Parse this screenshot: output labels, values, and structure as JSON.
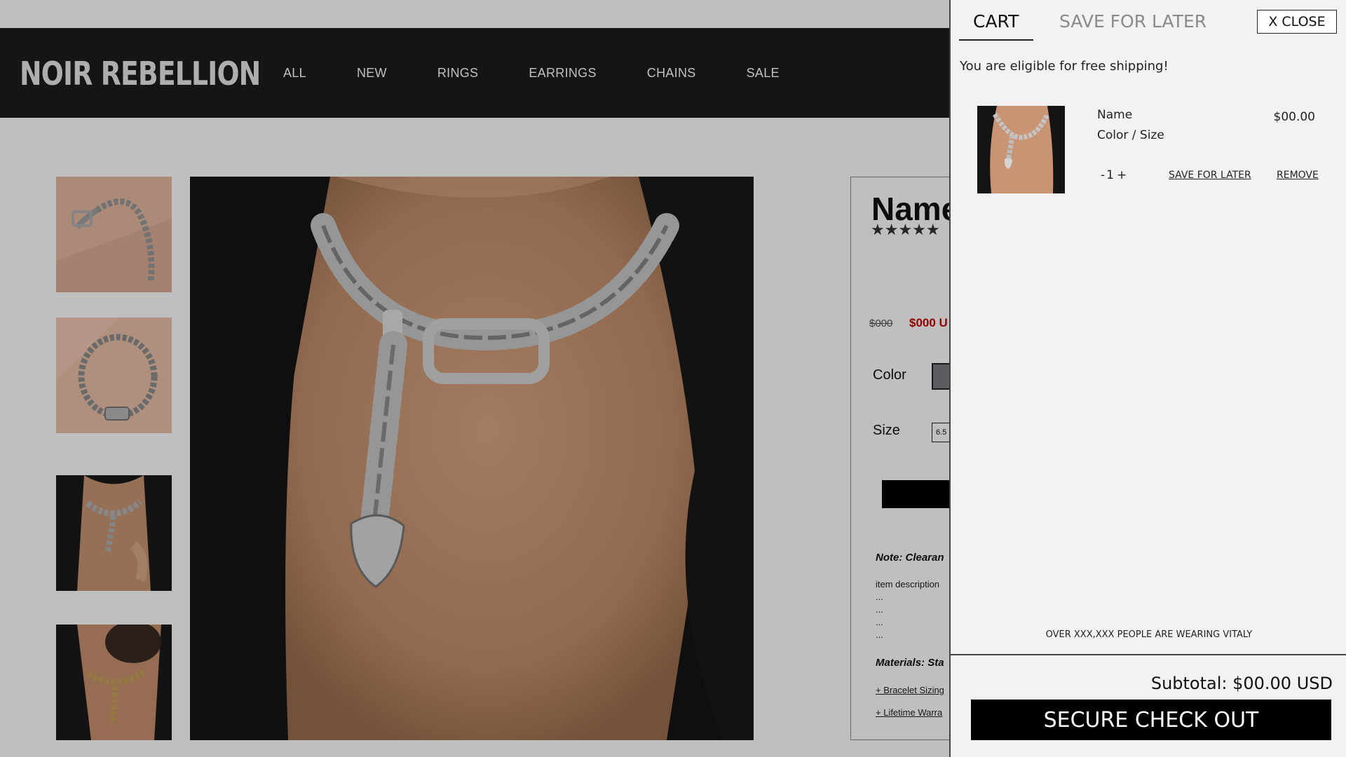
{
  "store": {
    "logo": "NOIR REBELLION",
    "nav": [
      "ALL",
      "NEW",
      "RINGS",
      "EARRINGS",
      "CHAINS",
      "SALE"
    ]
  },
  "product": {
    "name": "Name",
    "stars": "★★★★★",
    "price_old": "$000",
    "price_new": "$000 U",
    "color_label": "Color",
    "size_label": "Size",
    "size_value": "6.5",
    "note": "Note: Clearan",
    "description": "item description\n...\n...\n...\n...",
    "materials": "Materials: Sta",
    "link_sizing": "+ Bracelet Sizing",
    "link_warranty": "+ Lifetime Warra",
    "thumbnail_icons": [
      "necklace-flatlay-image",
      "necklace-coiled-image",
      "necklace-worn-silver-image",
      "necklace-worn-gold-image"
    ],
    "main_image_icon": "necklace-worn-silver-image"
  },
  "cart": {
    "tab_cart": "CART",
    "tab_save_for_later": "SAVE FOR LATER",
    "close_label": "X CLOSE",
    "free_shipping": "You are eligible for free shipping!",
    "item": {
      "name": "Name",
      "variant": "Color / Size",
      "price": "$00.00",
      "qty_minus": "-",
      "qty": "1",
      "qty_plus": "+",
      "save_for_later": "SAVE FOR LATER",
      "remove": "REMOVE"
    },
    "promo": "OVER XXX,XXX PEOPLE ARE WEARING VITALY",
    "subtotal": "Subtotal: $00.00 USD",
    "checkout": "SECURE CHECK OUT"
  },
  "colors": {
    "overlay_dim": "#000000",
    "sale_price": "#c20000",
    "drawer_bg": "#f2f2f2",
    "navbar_bg": "#1c1c1c"
  }
}
